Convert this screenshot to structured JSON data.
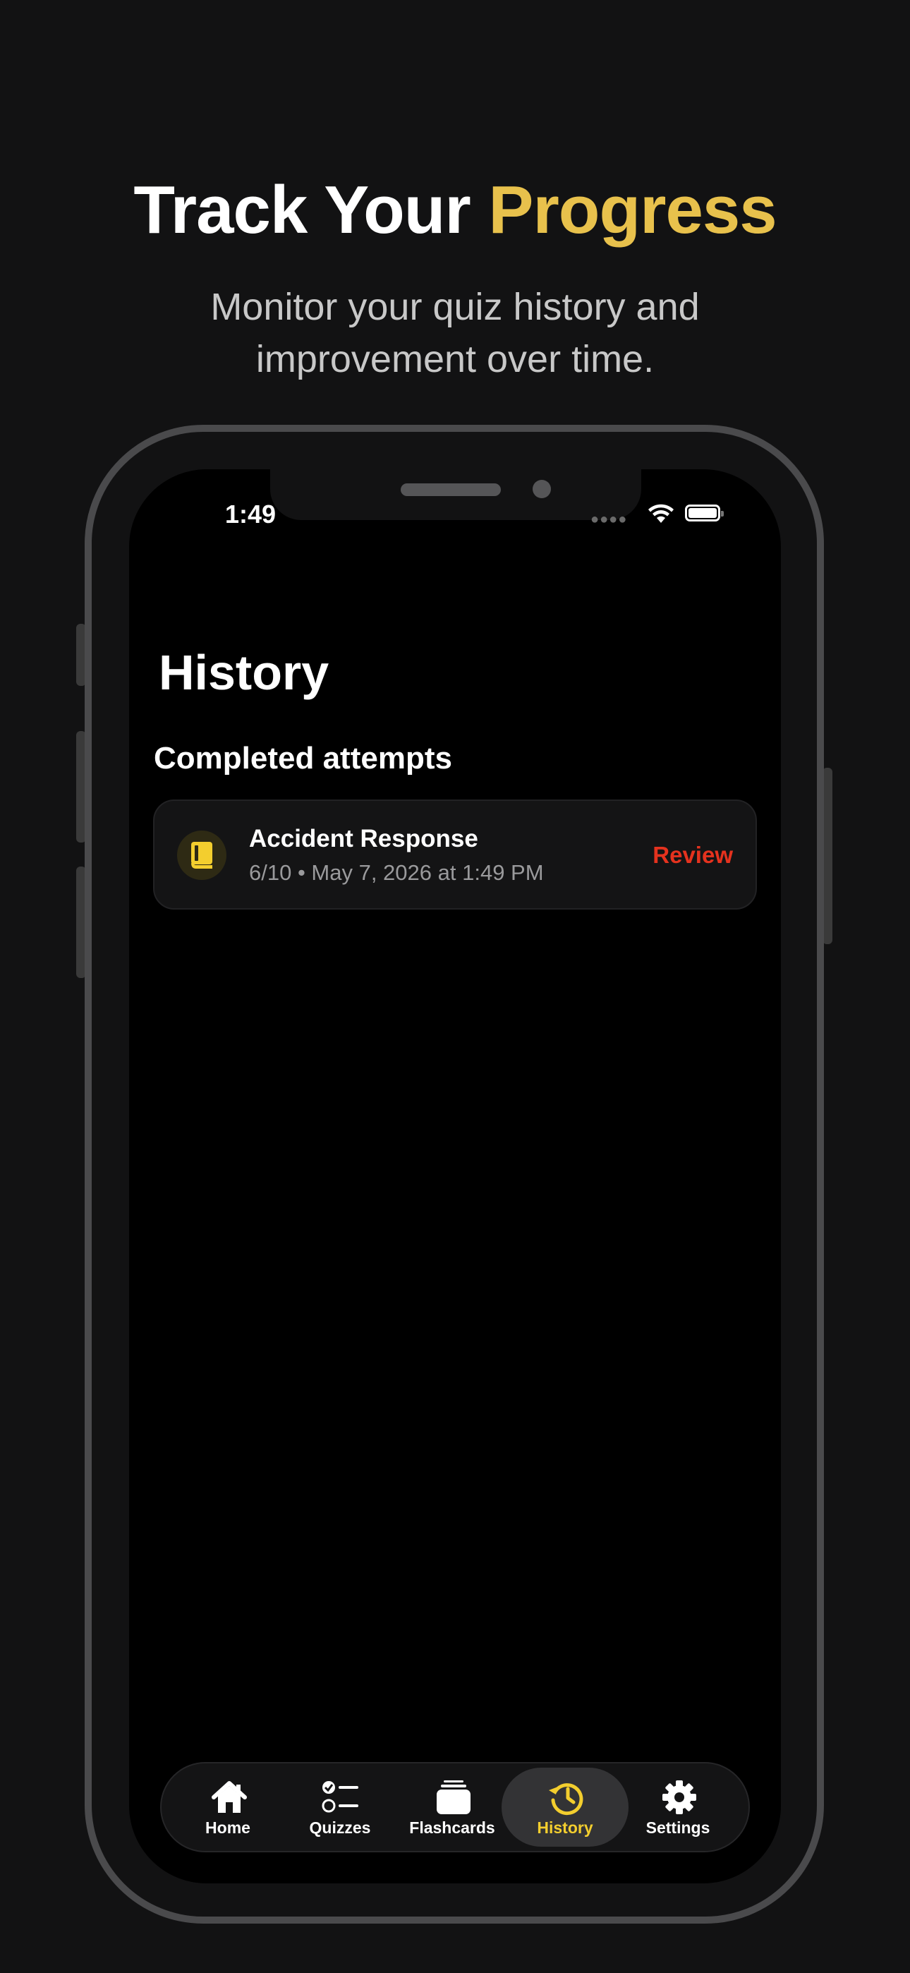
{
  "marketing": {
    "headline_part1": "Track Your ",
    "headline_accent": "Progress",
    "subtitle_line1": "Monitor your quiz history and",
    "subtitle_line2": "improvement over time."
  },
  "status_bar": {
    "time": "1:49"
  },
  "page": {
    "title": "History",
    "section_title": "Completed attempts"
  },
  "attempts": [
    {
      "title": "Accident Response",
      "meta": "6/10 • May 7, 2026 at 1:49 PM",
      "action_label": "Review",
      "icon": "book-icon"
    }
  ],
  "tab_bar": {
    "tabs": [
      {
        "label": "Home",
        "icon": "house-icon"
      },
      {
        "label": "Quizzes",
        "icon": "checklist-icon"
      },
      {
        "label": "Flashcards",
        "icon": "cards-stack-icon"
      },
      {
        "label": "History",
        "icon": "history-clock-icon",
        "active": true
      },
      {
        "label": "Settings",
        "icon": "gear-icon"
      }
    ]
  },
  "colors": {
    "accent": "#E8C14C",
    "tab_active": "#F3CE2E",
    "review": "#E5321E",
    "background": "#121213"
  }
}
